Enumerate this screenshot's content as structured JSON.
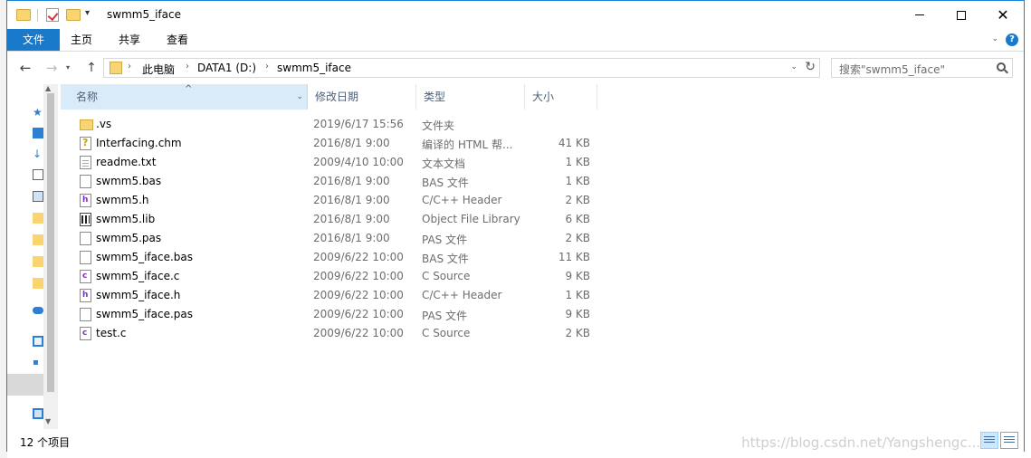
{
  "window": {
    "title": "swmm5_iface",
    "controls": {
      "minimize": "minimize",
      "maximize": "maximize",
      "close": "✕"
    }
  },
  "ribbon": {
    "tabs": [
      {
        "label": "文件",
        "active": true
      },
      {
        "label": "主页"
      },
      {
        "label": "共享"
      },
      {
        "label": "查看"
      }
    ],
    "help_label": "?"
  },
  "address": {
    "crumbs": [
      "此电脑",
      "DATA1 (D:)",
      "swmm5_iface"
    ],
    "separator": "›"
  },
  "search": {
    "placeholder": "搜索\"swmm5_iface\""
  },
  "columns": {
    "name": "名称",
    "date": "修改日期",
    "type": "类型",
    "size": "大小"
  },
  "files": [
    {
      "name": ".vs",
      "date": "2019/6/17 15:56",
      "type": "文件夹",
      "size": "",
      "icon": "folder-icon"
    },
    {
      "name": "Interfacing.chm",
      "date": "2016/8/1 9:00",
      "type": "编译的 HTML 帮...",
      "size": "41 KB",
      "icon": "chm-help-icon"
    },
    {
      "name": "readme.txt",
      "date": "2009/4/10 10:00",
      "type": "文本文档",
      "size": "1 KB",
      "icon": "text-document-icon"
    },
    {
      "name": "swmm5.bas",
      "date": "2016/8/1 9:00",
      "type": "BAS 文件",
      "size": "1 KB",
      "icon": "blank-file-icon"
    },
    {
      "name": "swmm5.h",
      "date": "2016/8/1 9:00",
      "type": "C/C++ Header",
      "size": "2 KB",
      "icon": "header-file-icon"
    },
    {
      "name": "swmm5.lib",
      "date": "2016/8/1 9:00",
      "type": "Object File Library",
      "size": "6 KB",
      "icon": "library-file-icon"
    },
    {
      "name": "swmm5.pas",
      "date": "2016/8/1 9:00",
      "type": "PAS 文件",
      "size": "2 KB",
      "icon": "blank-file-icon"
    },
    {
      "name": "swmm5_iface.bas",
      "date": "2009/6/22 10:00",
      "type": "BAS 文件",
      "size": "11 KB",
      "icon": "blank-file-icon"
    },
    {
      "name": "swmm5_iface.c",
      "date": "2009/6/22 10:00",
      "type": "C Source",
      "size": "9 KB",
      "icon": "c-source-file-icon"
    },
    {
      "name": "swmm5_iface.h",
      "date": "2009/6/22 10:00",
      "type": "C/C++ Header",
      "size": "1 KB",
      "icon": "header-file-icon"
    },
    {
      "name": "swmm5_iface.pas",
      "date": "2009/6/22 10:00",
      "type": "PAS 文件",
      "size": "9 KB",
      "icon": "blank-file-icon"
    },
    {
      "name": "test.c",
      "date": "2009/6/22 10:00",
      "type": "C Source",
      "size": "2 KB",
      "icon": "c-source-file-icon"
    }
  ],
  "status": {
    "item_count": "12 个项目"
  },
  "watermark": "https://blog.csdn.net/Yangshengc...",
  "colors": {
    "accent": "#1979ca",
    "selected_header": "#d9ebf9",
    "folder": "#f8d572",
    "border": "#1883d7"
  }
}
